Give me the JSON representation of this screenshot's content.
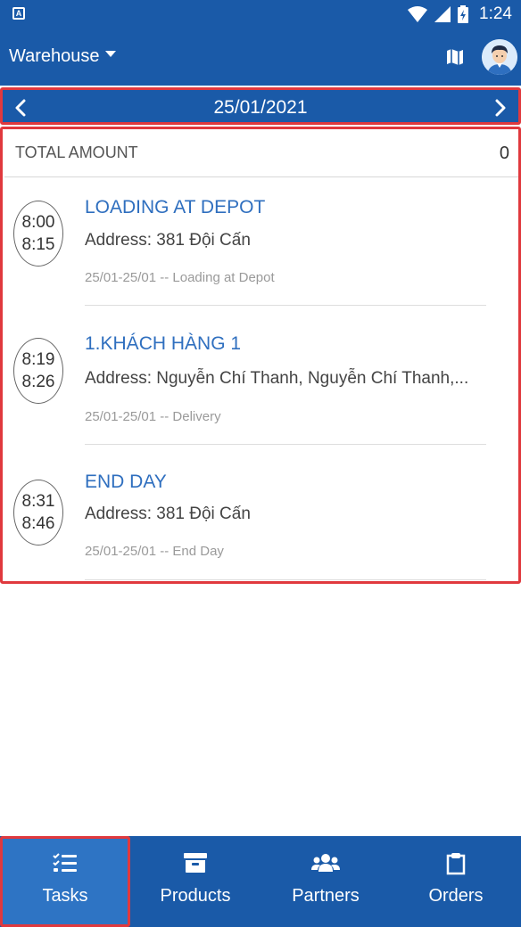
{
  "status_bar": {
    "app_badge": "A",
    "time": "1:24",
    "icons": [
      "wifi-icon",
      "signal-icon",
      "battery-icon"
    ]
  },
  "app_bar": {
    "title": "Warehouse",
    "map_icon": "map-icon",
    "avatar_icon": "user-avatar"
  },
  "date_nav": {
    "date": "25/01/2021",
    "prev_icon": "chevron-left-icon",
    "next_icon": "chevron-right-icon"
  },
  "summary": {
    "label": "TOTAL AMOUNT",
    "value": "0"
  },
  "tasks": [
    {
      "start": "8:00",
      "end": "8:15",
      "title": "LOADING AT DEPOT",
      "address": "Address: 381 Đội Cấn",
      "meta": "25/01-25/01 -- Loading at Depot"
    },
    {
      "start": "8:19",
      "end": "8:26",
      "title": "1.KHÁCH HÀNG 1",
      "address": "Address: Nguyễn Chí Thanh, Nguyễn Chí Thanh,...",
      "meta": "25/01-25/01 -- Delivery"
    },
    {
      "start": "8:31",
      "end": "8:46",
      "title": "END DAY",
      "address": "Address: 381 Đội Cấn",
      "meta": "25/01-25/01 -- End Day"
    }
  ],
  "bottom_nav": {
    "items": [
      {
        "label": "Tasks",
        "icon": "tasks-icon",
        "active": true
      },
      {
        "label": "Products",
        "icon": "archive-icon",
        "active": false
      },
      {
        "label": "Partners",
        "icon": "users-icon",
        "active": false
      },
      {
        "label": "Orders",
        "icon": "clipboard-icon",
        "active": false
      }
    ]
  },
  "colors": {
    "primary": "#1a5aa8",
    "active_tab": "#2e74c4",
    "highlight_border": "#e0393e",
    "task_title": "#2f6fbf"
  }
}
